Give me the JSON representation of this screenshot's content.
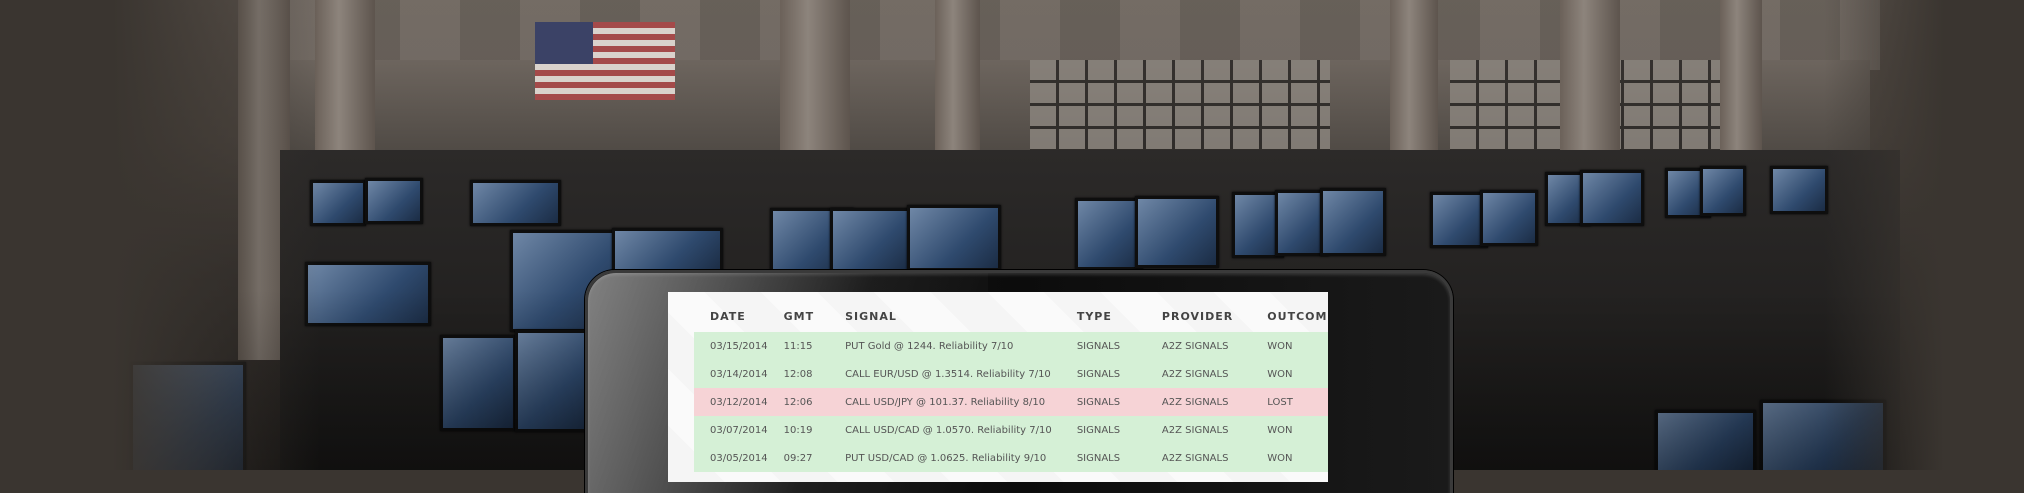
{
  "signals_table": {
    "headers": {
      "date": "DATE",
      "gmt": "GMT",
      "signal": "SIGNAL",
      "type": "TYPE",
      "provider": "PROVIDER",
      "outcome": "OUTCOME"
    },
    "rows": [
      {
        "date": "03/15/2014",
        "gmt": "11:15",
        "signal": "PUT Gold @ 1244. Reliability 7/10",
        "type": "SIGNALS",
        "provider": "A2Z SIGNALS",
        "outcome": "WON",
        "status": "won"
      },
      {
        "date": "03/14/2014",
        "gmt": "12:08",
        "signal": "CALL EUR/USD @ 1.3514. Reliability 7/10",
        "type": "SIGNALS",
        "provider": "A2Z SIGNALS",
        "outcome": "WON",
        "status": "won"
      },
      {
        "date": "03/12/2014",
        "gmt": "12:06",
        "signal": "CALL USD/JPY @ 101.37. Reliability 8/10",
        "type": "SIGNALS",
        "provider": "A2Z SIGNALS",
        "outcome": "LOST",
        "status": "lost"
      },
      {
        "date": "03/07/2014",
        "gmt": "10:19",
        "signal": "CALL USD/CAD @ 1.0570. Reliability 7/10",
        "type": "SIGNALS",
        "provider": "A2Z SIGNALS",
        "outcome": "WON",
        "status": "won"
      },
      {
        "date": "03/05/2014",
        "gmt": "09:27",
        "signal": "PUT USD/CAD @ 1.0625. Reliability 9/10",
        "type": "SIGNALS",
        "provider": "A2Z SIGNALS",
        "outcome": "WON",
        "status": "won"
      }
    ]
  },
  "colors": {
    "won_row": "#d5f0d6",
    "lost_row": "#f6d3d6",
    "device_frame": "#111111",
    "background": "#3a3530"
  }
}
